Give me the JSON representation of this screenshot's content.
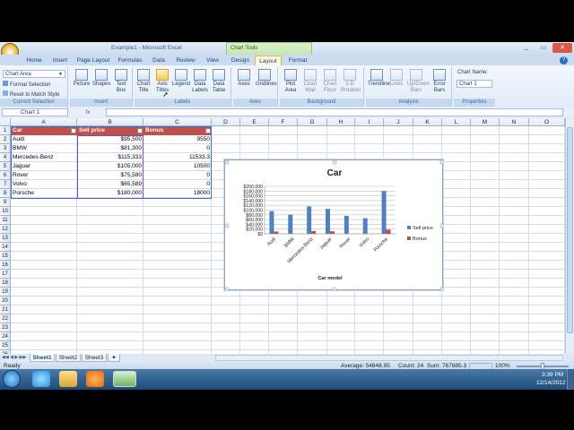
{
  "title": {
    "doc": "Example1 - Microsoft Excel",
    "context": "Chart Tools"
  },
  "tabs": [
    "Home",
    "Insert",
    "Page Layout",
    "Formulas",
    "Data",
    "Review",
    "View",
    "Design",
    "Layout",
    "Format"
  ],
  "ribbon": {
    "current_selection": {
      "dropdown": "Chart Area",
      "format_selection": "Format Selection",
      "reset": "Reset to Match Style",
      "label": "Current Selection"
    },
    "insert": {
      "buttons": [
        "Picture",
        "Shapes",
        "Text Box"
      ],
      "label": "Insert"
    },
    "labels": {
      "buttons": [
        "Chart Title",
        "Axis Titles",
        "Legend",
        "Data Labels",
        "Data Table"
      ],
      "label": "Labels"
    },
    "axes": {
      "buttons": [
        "Axes",
        "Gridlines"
      ],
      "label": "Axes"
    },
    "background": {
      "buttons": [
        "Plot Area",
        "Chart Wall",
        "Chart Floor",
        "3-D Rotation"
      ],
      "label": "Background"
    },
    "analysis": {
      "buttons": [
        "Trendline",
        "Lines",
        "Up/Down Bars",
        "Error Bars"
      ],
      "label": "Analysis"
    },
    "properties": {
      "chart_name_label": "Chart Name:",
      "chart_name": "Chart 1",
      "label": "Properties"
    }
  },
  "formula_bar": {
    "name_box": "Chart 1",
    "fx": "fx",
    "value": ""
  },
  "columns": [
    "A",
    "B",
    "C",
    "D",
    "E",
    "F",
    "G",
    "H",
    "I",
    "J",
    "K",
    "L",
    "M",
    "N",
    "O"
  ],
  "rows": [
    "1",
    "2",
    "3",
    "4",
    "5",
    "6",
    "7",
    "8",
    "9",
    "10",
    "11",
    "12",
    "13",
    "14",
    "15",
    "16",
    "17",
    "18",
    "19",
    "20",
    "21",
    "22",
    "23",
    "24",
    "25",
    "26"
  ],
  "table": {
    "headers": [
      "Car",
      "Sell price",
      "Bonus"
    ],
    "rows": [
      [
        "Audi",
        "$95,500",
        "9550"
      ],
      [
        "BMW",
        "$81,300",
        "0"
      ],
      [
        "Mercedes-Benz",
        "$115,333",
        "11533.3"
      ],
      [
        "Jaguar",
        "$105,000",
        "10500"
      ],
      [
        "Rover",
        "$75,580",
        "0"
      ],
      [
        "Volvo",
        "$65,589",
        "0"
      ],
      [
        "Porsche",
        "$180,000",
        "18000"
      ]
    ]
  },
  "chart_data": {
    "type": "bar",
    "title": "Car",
    "xlabel": "Car model",
    "ylabel": "",
    "categories": [
      "Audi",
      "BMW",
      "Mercedes-Benz",
      "Jaguar",
      "Rover",
      "Volvo",
      "Porsche"
    ],
    "series": [
      {
        "name": "Sell price",
        "color": "#4f81bd",
        "values": [
          95500,
          81300,
          115333,
          105000,
          75580,
          65589,
          180000
        ]
      },
      {
        "name": "Bonus",
        "color": "#c0504d",
        "values": [
          9550,
          0,
          11533.3,
          10500,
          0,
          0,
          18000
        ]
      }
    ],
    "yticks": [
      "$0",
      "$20,000",
      "$40,000",
      "$60,000",
      "$80,000",
      "$100,000",
      "$120,000",
      "$140,000",
      "$160,000",
      "$180,000",
      "$200,000"
    ],
    "ylim": [
      0,
      200000
    ],
    "legend": "right",
    "grid": true
  },
  "sheets": [
    "Sheet1",
    "Sheet2",
    "Sheet3"
  ],
  "status": {
    "ready": "Ready",
    "average": "Average: 54848.95",
    "count": "Count: 24",
    "sum": "Sum: 767885.3",
    "zoom": "100%"
  },
  "taskbar": {
    "time": "3:39 PM",
    "date": "12/14/2012"
  }
}
